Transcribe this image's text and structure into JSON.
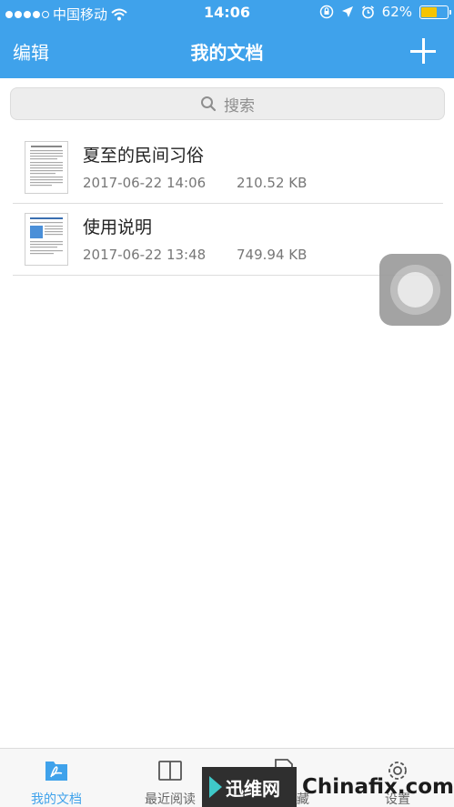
{
  "status_bar": {
    "carrier": "中国移动",
    "time": "14:06",
    "battery": "62%",
    "battery_level": 0.62
  },
  "navbar": {
    "edit_label": "编辑",
    "title": "我的文档"
  },
  "search": {
    "placeholder": "搜索"
  },
  "documents": [
    {
      "name": "夏至的民间习俗",
      "date": "2017-06-22 14:06",
      "size": "210.52 KB"
    },
    {
      "name": "使用说明",
      "date": "2017-06-22 13:48",
      "size": "749.94 KB"
    }
  ],
  "tabs": [
    {
      "label": "我的文档",
      "icon": "pdf-document-icon",
      "active": true
    },
    {
      "label": "最近阅读",
      "icon": "open-book-icon",
      "active": false
    },
    {
      "label": "我的收藏",
      "icon": "bookmark-document-icon",
      "active": false
    },
    {
      "label": "设置",
      "icon": "gear-icon",
      "active": false
    }
  ],
  "watermark": {
    "brand": "迅维网",
    "site": "Chinafix.com"
  },
  "colors": {
    "accent": "#3fa2eb",
    "battery": "#f5c400"
  }
}
